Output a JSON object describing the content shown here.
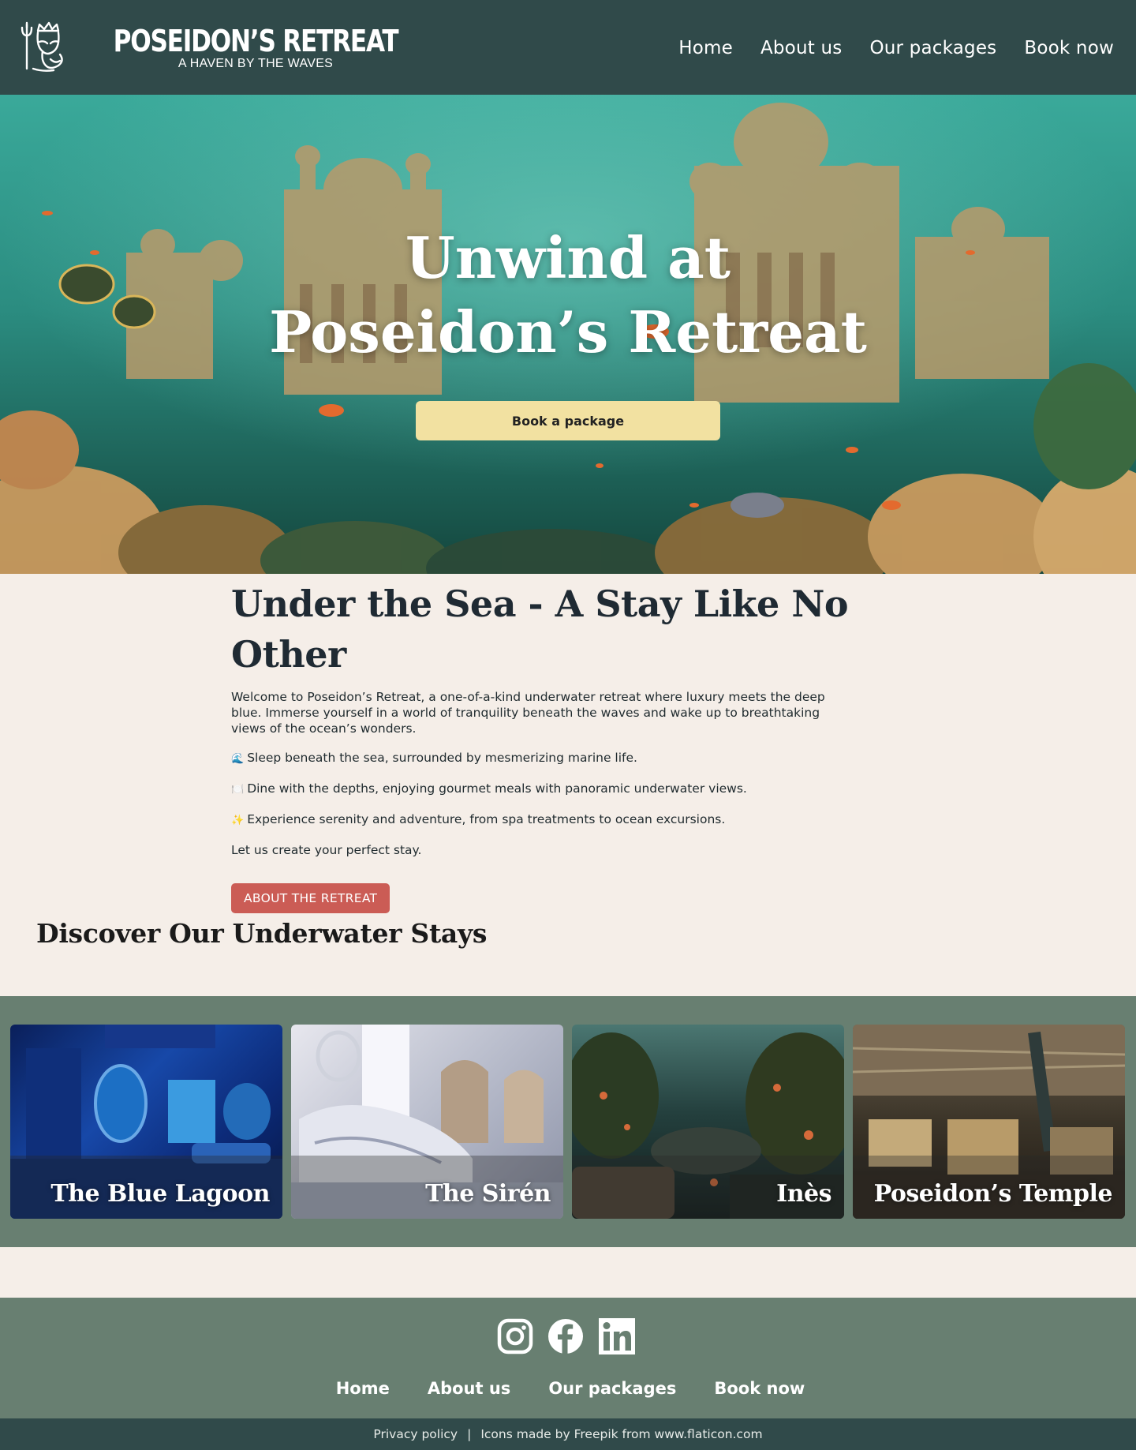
{
  "header": {
    "brand_name": "POSEIDON’S RETREAT",
    "brand_tagline": "A HAVEN BY THE WAVES",
    "nav": [
      "Home",
      "About us",
      "Our packages",
      "Book now"
    ]
  },
  "hero": {
    "title_line1": "Unwind at",
    "title_line2": "Poseidon’s Retreat",
    "button_label": "Book a package"
  },
  "intro": {
    "heading": "Under the Sea - A Stay Like No Other",
    "welcome": "Welcome to Poseidon’s Retreat, a one-of-a-kind underwater retreat where luxury meets the deep blue. Immerse yourself in a world of tranquility beneath the waves and wake up to breathtaking views of the ocean’s wonders.",
    "items": [
      {
        "emoji": "🌊",
        "text": "Sleep beneath the sea, surrounded by mesmerizing marine life."
      },
      {
        "emoji": "🍽️",
        "text": "Dine with the depths, enjoying gourmet meals with panoramic underwater views."
      },
      {
        "emoji": "✨",
        "text": "Experience serenity and adventure, from spa treatments to ocean excursions."
      }
    ],
    "closing": "Let us create your perfect stay.",
    "button_label": "ABOUT THE RETREAT"
  },
  "discover": {
    "title": "Discover Our Underwater Stays",
    "stays": [
      "The Blue Lagoon",
      "The Sirén",
      "Inès",
      "Poseidon’s Temple"
    ]
  },
  "footer": {
    "socials": [
      "instagram-icon",
      "facebook-icon",
      "linkedin-icon"
    ],
    "nav": [
      "Home",
      "About us",
      "Our packages",
      "Book now"
    ],
    "privacy_label": "Privacy policy",
    "separator": "|",
    "credits": "Icons made by Freepik from www.flaticon.com"
  },
  "colors": {
    "header_bg": "#304a4a",
    "accent_sand": "#f2e1a1",
    "accent_coral": "#cb5c55",
    "section_green": "#687f71",
    "page_bg": "#f5eee8"
  }
}
